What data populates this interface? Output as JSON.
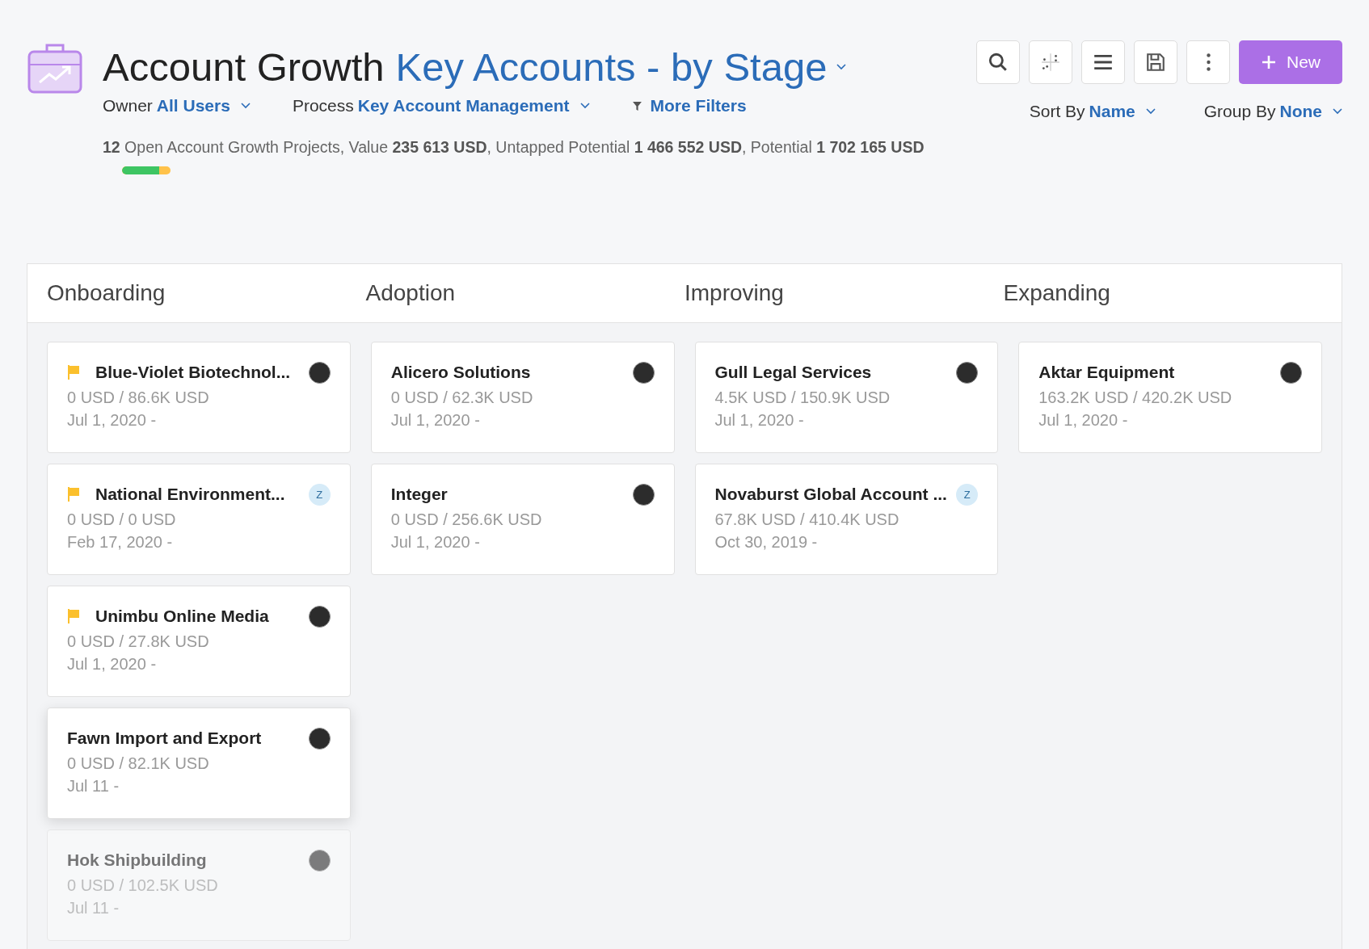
{
  "header": {
    "title": "Account Growth",
    "view": "Key Accounts - by Stage"
  },
  "toolbar": {
    "new_button": "New"
  },
  "filters": [
    {
      "label": "Owner",
      "value": "All Users"
    },
    {
      "label": "Process",
      "value": "Key Account Management"
    }
  ],
  "more_filters": "More Filters",
  "sorting": [
    {
      "label": "Sort By",
      "value": "Name"
    },
    {
      "label": "Group By",
      "value": "None"
    }
  ],
  "summary": {
    "count": "12",
    "text1": "Open Account Growth Projects, Value",
    "value": "235 613 USD",
    "text2": ", Untapped Potential",
    "untapped": "1 466 552 USD",
    "text3": ", Potential",
    "potential": "1 702 165 USD",
    "level": 0.77
  },
  "columns": [
    {
      "title": "Onboarding",
      "cards": [
        {
          "name": "Blue-Violet Biotechnol...",
          "amount": "0 USD / 86.6K USD",
          "date": "Jul 1, 2020 -",
          "flagged": true,
          "avatar": {
            "kind": "photo"
          },
          "raised": false,
          "faded": false
        },
        {
          "name": "National Environment...",
          "amount": "0 USD / 0 USD",
          "date": "Feb 17, 2020 -",
          "flagged": true,
          "avatar": {
            "kind": "initial",
            "letter": "Z"
          },
          "raised": false,
          "faded": false
        },
        {
          "name": "Unimbu Online Media",
          "amount": "0 USD / 27.8K USD",
          "date": "Jul 1, 2020 -",
          "flagged": true,
          "avatar": {
            "kind": "photo"
          },
          "raised": false,
          "faded": false
        },
        {
          "name": "Fawn Import and Export",
          "amount": "0 USD / 82.1K USD",
          "date": "Jul 11 -",
          "flagged": false,
          "avatar": {
            "kind": "photo"
          },
          "raised": true,
          "faded": false
        },
        {
          "name": "Hok Shipbuilding",
          "amount": "0 USD / 102.5K USD",
          "date": "Jul 11 -",
          "flagged": false,
          "avatar": {
            "kind": "photo"
          },
          "raised": false,
          "faded": true
        }
      ]
    },
    {
      "title": "Adoption",
      "cards": [
        {
          "name": "Alicero Solutions",
          "amount": "0 USD / 62.3K USD",
          "date": "Jul 1, 2020 -",
          "flagged": false,
          "avatar": {
            "kind": "photo"
          },
          "raised": false,
          "faded": false
        },
        {
          "name": "Integer",
          "amount": "0 USD / 256.6K USD",
          "date": "Jul 1, 2020 -",
          "flagged": false,
          "avatar": {
            "kind": "photo"
          },
          "raised": false,
          "faded": false
        }
      ]
    },
    {
      "title": "Improving",
      "cards": [
        {
          "name": "Gull Legal Services",
          "amount": "4.5K USD / 150.9K USD",
          "date": "Jul 1, 2020 -",
          "flagged": false,
          "avatar": {
            "kind": "photo"
          },
          "raised": false,
          "faded": false
        },
        {
          "name": "Novaburst Global Account ...",
          "amount": "67.8K USD / 410.4K USD",
          "date": "Oct 30, 2019 -",
          "flagged": false,
          "avatar": {
            "kind": "initial",
            "letter": "Z"
          },
          "raised": false,
          "faded": false
        }
      ]
    },
    {
      "title": "Expanding",
      "cards": [
        {
          "name": "Aktar Equipment",
          "amount": "163.2K USD / 420.2K USD",
          "date": "Jul 1, 2020 -",
          "flagged": false,
          "avatar": {
            "kind": "photo"
          },
          "raised": false,
          "faded": false
        }
      ]
    }
  ]
}
